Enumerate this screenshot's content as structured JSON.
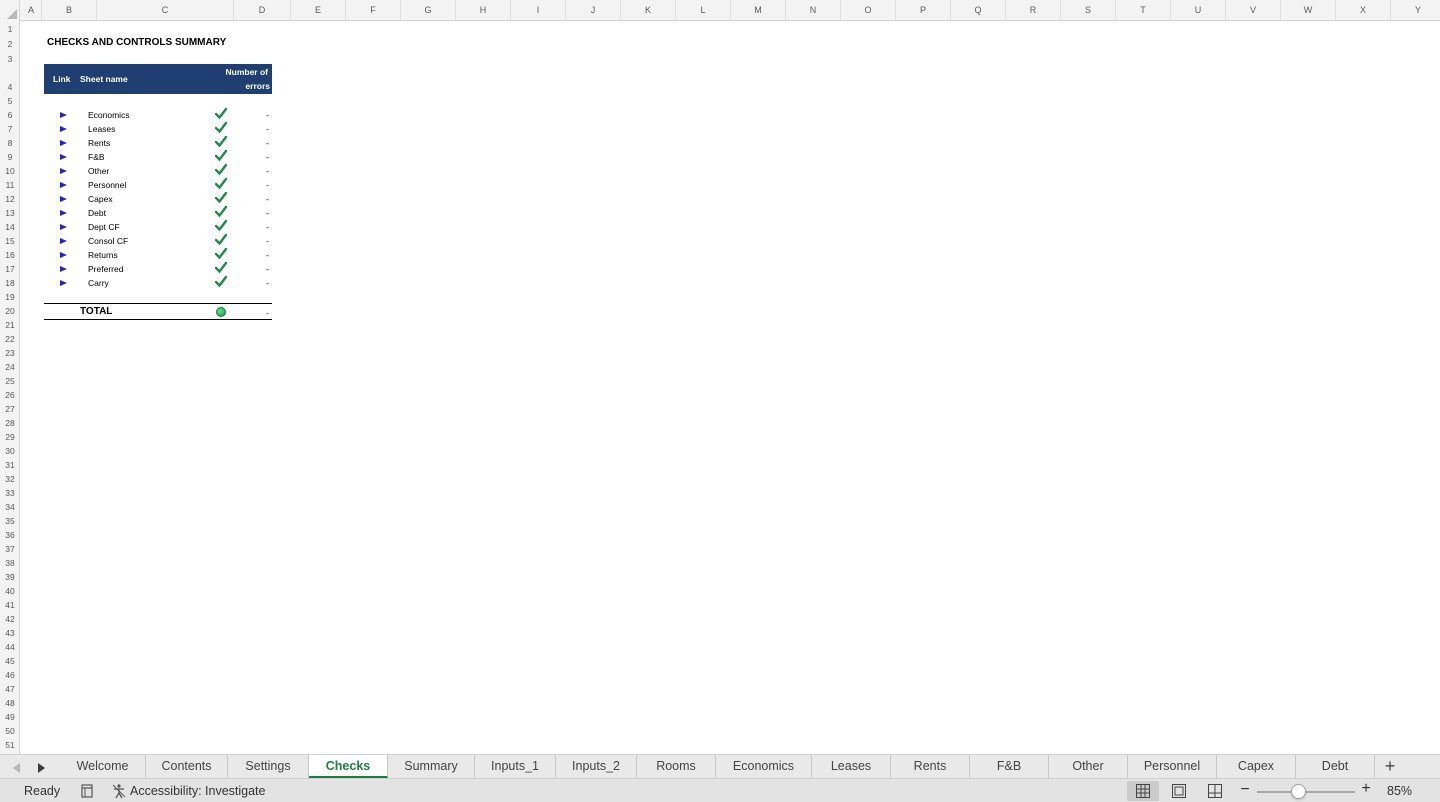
{
  "columns": [
    "A",
    "B",
    "C",
    "D",
    "E",
    "F",
    "G",
    "H",
    "I",
    "J",
    "K",
    "L",
    "M",
    "N",
    "O",
    "P",
    "Q",
    "R",
    "S",
    "T",
    "U",
    "V",
    "W",
    "X",
    "Y"
  ],
  "rows": [
    "1",
    "2",
    "3",
    "4",
    "5",
    "6",
    "7",
    "8",
    "9",
    "10",
    "11",
    "12",
    "13",
    "14",
    "15",
    "16",
    "17",
    "18",
    "19",
    "20",
    "21",
    "22",
    "23",
    "24",
    "25",
    "26",
    "27",
    "28",
    "29",
    "30",
    "31",
    "32",
    "33",
    "34",
    "35",
    "36",
    "37",
    "38",
    "39",
    "40",
    "41",
    "42",
    "43",
    "44",
    "45",
    "46",
    "47",
    "48",
    "49",
    "50",
    "51"
  ],
  "sheet": {
    "title": "CHECKS AND CONTROLS SUMMARY",
    "header": {
      "link": "Link",
      "sheet_name": "Sheet name",
      "errors_line1": "Number of",
      "errors_line2": "errors"
    },
    "items": [
      {
        "name": "Economics",
        "status": "ok",
        "errors": "-"
      },
      {
        "name": "Leases",
        "status": "ok",
        "errors": "-"
      },
      {
        "name": "Rents",
        "status": "ok",
        "errors": "-"
      },
      {
        "name": "F&B",
        "status": "ok",
        "errors": "-"
      },
      {
        "name": "Other",
        "status": "ok",
        "errors": "-"
      },
      {
        "name": "Personnel",
        "status": "ok",
        "errors": "-"
      },
      {
        "name": "Capex",
        "status": "ok",
        "errors": "-"
      },
      {
        "name": "Debt",
        "status": "ok",
        "errors": "-"
      },
      {
        "name": "Dept CF",
        "status": "ok",
        "errors": "-"
      },
      {
        "name": "Consol CF",
        "status": "ok",
        "errors": "-"
      },
      {
        "name": "Returns",
        "status": "ok",
        "errors": "-"
      },
      {
        "name": "Preferred",
        "status": "ok",
        "errors": "-"
      },
      {
        "name": "Carry",
        "status": "ok",
        "errors": "-"
      }
    ],
    "total": {
      "label": "TOTAL",
      "status": "green",
      "errors": "-"
    }
  },
  "tabs": {
    "items": [
      "Welcome",
      "Contents",
      "Settings",
      "Checks",
      "Summary",
      "Inputs_1",
      "Inputs_2",
      "Rooms",
      "Economics",
      "Leases",
      "Rents",
      "F&B",
      "Other",
      "Personnel",
      "Capex",
      "Debt"
    ],
    "active": "Checks",
    "add_label": "+"
  },
  "status_bar": {
    "ready": "Ready",
    "accessibility": "Accessibility: Investigate",
    "zoom_minus": "−",
    "zoom_plus": "+",
    "zoom_level": "85%",
    "zoom_percent": 85
  },
  "colors": {
    "header_fill": "#1f3e72",
    "link_arrow": "#2525d0",
    "check": "#1f8a4c",
    "active_tab": "#1a7f45"
  }
}
